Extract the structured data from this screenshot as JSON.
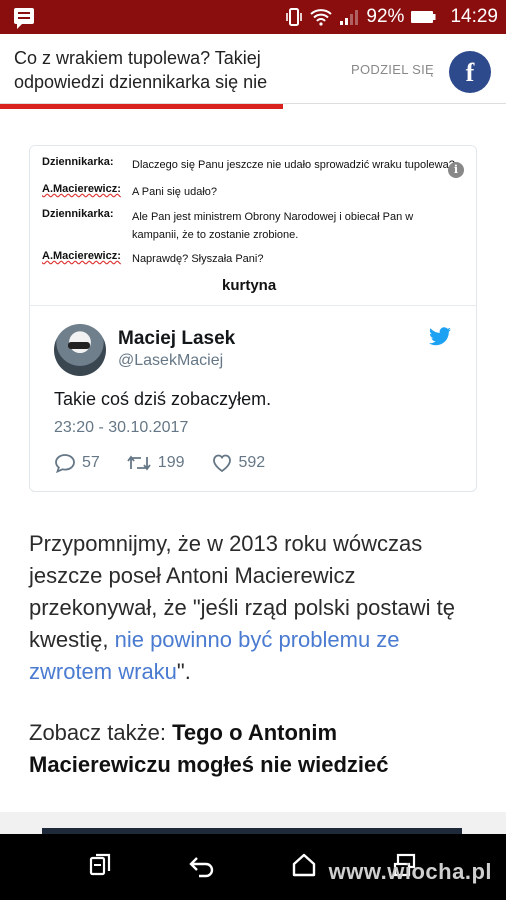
{
  "status_bar": {
    "battery": "92%",
    "time": "14:29",
    "icons": [
      "message-icon",
      "vibrate-icon",
      "wifi-icon",
      "signal-icon",
      "battery-icon"
    ]
  },
  "header": {
    "title": "Co z wrakiem tupolewa? Takiej odpowiedzi dziennikarka się nie",
    "share_label": "PODZIEL SIĘ",
    "fb_label": "f",
    "reading_progress_percent": 56,
    "accent_color": "#d9221d",
    "fb_color": "#2d4a8c"
  },
  "tweet": {
    "dialog": [
      {
        "speaker": "Dziennikarka:",
        "text": "Dlaczego się Panu jeszcze nie udało sprowadzić wraku tupolewa?"
      },
      {
        "speaker": "A.Macierewicz:",
        "text": "A Pani się udało?"
      },
      {
        "speaker": "Dziennikarka:",
        "text": "Ale Pan jest ministrem Obrony Narodowej i obiecał Pan w kampanii, że to zostanie zrobione."
      },
      {
        "speaker": "A.Macierewicz:",
        "text": "Naprawdę? Słyszała Pani?"
      }
    ],
    "punchline": "kurtyna",
    "author_name": "Maciej Lasek",
    "author_handle": "@LasekMaciej",
    "text": "Takie coś dziś zobaczyłem.",
    "timestamp": "23:20 - 30.10.2017",
    "replies": "57",
    "retweets": "199",
    "likes": "592",
    "link_color": "#1da1f2"
  },
  "article": {
    "paragraph_before_link": "Przypomnijmy, że w 2013 roku wówczas jeszcze poseł Antoni Macierewicz przekonywał, że \"jeśli rząd polski postawi tę kwestię, ",
    "paragraph_link": "nie powinno być problemu ze zwrotem wraku",
    "paragraph_after_link": "\".",
    "see_also_label": "Zobacz także: ",
    "see_also_link": "Tego o Antonim Macierewiczu mogłeś nie wiedzieć"
  },
  "navbar": {
    "buttons": [
      "recent-apps-icon",
      "back-icon",
      "home-icon",
      "multiwindow-icon"
    ],
    "watermark": "www.wiocha.pl"
  }
}
